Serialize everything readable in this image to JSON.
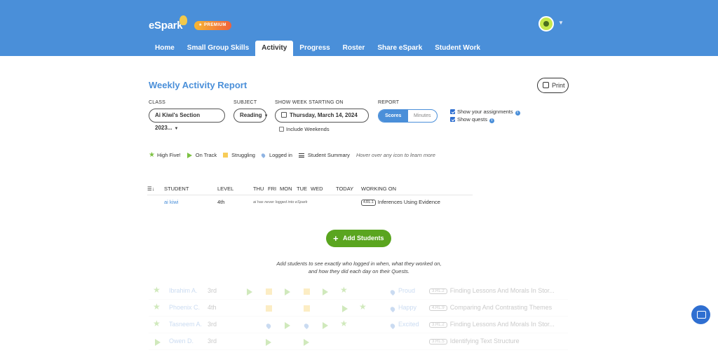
{
  "brand": {
    "logo": "eSpark",
    "badge": "★ PREMIUM"
  },
  "nav": [
    "Home",
    "Small Group Skills",
    "Activity",
    "Progress",
    "Roster",
    "Share eSpark",
    "Student Work"
  ],
  "nav_active": "Activity",
  "report": {
    "title": "Weekly Activity Report",
    "print_label": "Print",
    "class_label": "CLASS",
    "class_value": "Ai Kiwi's Section 2023...",
    "subject_label": "SUBJECT",
    "subject_value": "Reading",
    "week_label": "SHOW WEEK STARTING ON",
    "week_value": "Thursday, March 14, 2024",
    "include_weekends": "Include Weekends",
    "report_label": "REPORT",
    "report_options": [
      "Scores",
      "Minutes"
    ],
    "report_selected": "Scores",
    "show_assignments": "Show your assignments",
    "show_quests": "Show quests"
  },
  "legend": {
    "high_five": "High Five!",
    "on_track": "On Track",
    "struggling": "Struggling",
    "logged_in": "Logged in",
    "student_summary": "Student Summary",
    "hint": "Hover over any icon to learn more"
  },
  "table": {
    "headers": {
      "student": "STUDENT",
      "level": "LEVEL",
      "thu": "THU",
      "fri": "FRI",
      "mon": "MON",
      "tue": "TUE",
      "wed": "WED",
      "today": "TODAY",
      "working_on": "WORKING ON"
    },
    "rows": [
      {
        "student": "ai kiwi",
        "level": "4th",
        "note": "ai has never logged into eSpark",
        "standard": "4.RL.1",
        "skill": "Inferences Using Evidence"
      }
    ]
  },
  "add_students": {
    "button": "Add Students",
    "message_line1": "Add students to see exactly who logged in when, what they worked on,",
    "message_line2": "and how they did each day on their Quests."
  },
  "preview_rows": [
    {
      "name": "Ibrahim A.",
      "level": "3rd",
      "mood": "Proud",
      "standard": "3.RL.2",
      "topic": "Finding Lessons And Morals In Stor..."
    },
    {
      "name": "Phoenix C.",
      "level": "4th",
      "mood": "Happy",
      "standard": "4.RL.9",
      "topic": "Comparing And Contrasting Themes"
    },
    {
      "name": "Tasneem A.",
      "level": "3rd",
      "mood": "Excited",
      "standard": "3.RL.2",
      "topic": "Finding Lessons And Morals In Stor..."
    },
    {
      "name": "Owen D.",
      "level": "3rd",
      "mood": "",
      "standard": "3.RL.5",
      "topic": "Identifying Text Structure"
    }
  ],
  "colors": {
    "header_blue": "#4a8fd9",
    "green": "#5aa51f",
    "yellow": "#f7cc58"
  }
}
